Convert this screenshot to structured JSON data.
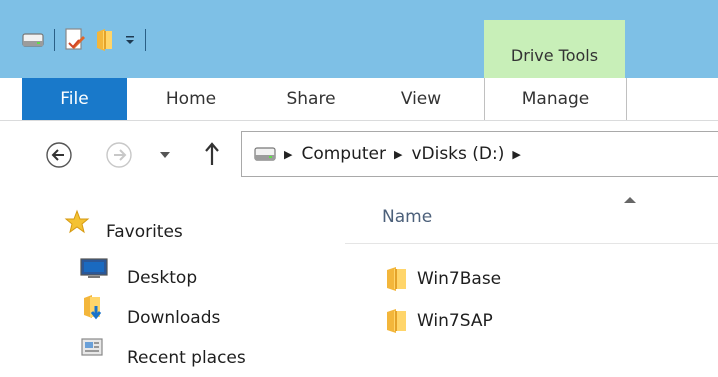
{
  "ribbon": {
    "contextual_group": "Drive Tools",
    "tabs": [
      {
        "label": "File"
      },
      {
        "label": "Home"
      },
      {
        "label": "Share"
      },
      {
        "label": "View"
      },
      {
        "label": "Manage"
      }
    ]
  },
  "address": {
    "crumbs": [
      "Computer",
      "vDisks (D:)"
    ]
  },
  "columns": {
    "name": "Name"
  },
  "nav": {
    "favorites": "Favorites",
    "items": [
      {
        "label": "Desktop",
        "icon": "desktop-icon"
      },
      {
        "label": "Downloads",
        "icon": "downloads-folder-icon"
      },
      {
        "label": "Recent places",
        "icon": "recent-places-icon"
      }
    ]
  },
  "files": [
    {
      "name": "Win7Base",
      "icon": "folder-icon"
    },
    {
      "name": "Win7SAP",
      "icon": "folder-icon"
    }
  ],
  "colors": {
    "titlebar": "#7ec0e6",
    "contextual": "#c8efb8",
    "file_tab": "#1979ca"
  }
}
